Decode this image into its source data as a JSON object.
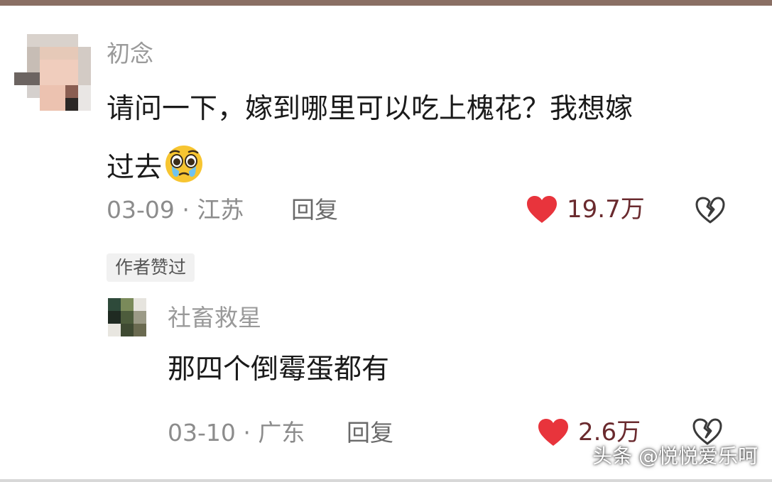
{
  "comment": {
    "username": "初念",
    "text_line1": "请问一下，嫁到哪里可以吃上槐花？我想嫁",
    "text_line2": "过去",
    "emoji": "pleading-face-icon",
    "date": "03-09",
    "separator": "·",
    "location": "江苏",
    "reply_label": "回复",
    "like_count": "19.7万"
  },
  "author_badge": "作者赞过",
  "reply": {
    "username": "社畜救星",
    "text": "那四个倒霉蛋都有",
    "date": "03-10",
    "separator": "·",
    "location": "广东",
    "reply_label": "回复",
    "like_count": "2.6万"
  },
  "watermark": "头条 @悦悦爱乐呵",
  "colors": {
    "like_heart": "#e8343c",
    "like_count": "#6a2a2e",
    "meta_gray": "#8c8c8c",
    "text_dark": "#1a1a1a",
    "top_bar": "#8a6f64"
  }
}
